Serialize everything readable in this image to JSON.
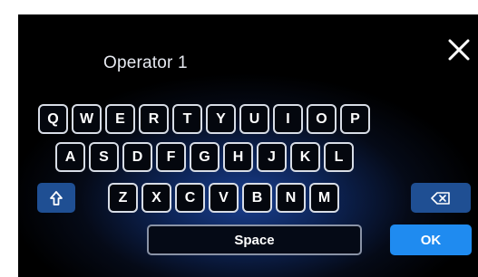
{
  "input": {
    "value": "Operator 1"
  },
  "keyboard": {
    "row1": [
      "Q",
      "W",
      "E",
      "R",
      "T",
      "Y",
      "U",
      "I",
      "O",
      "P"
    ],
    "row2": [
      "A",
      "S",
      "D",
      "F",
      "G",
      "H",
      "J",
      "K",
      "L"
    ],
    "row3": [
      "Z",
      "X",
      "C",
      "V",
      "B",
      "N",
      "M"
    ],
    "space_label": "Space",
    "ok_label": "OK"
  },
  "icons": {
    "close": "close-icon",
    "shift": "shift-icon",
    "backspace": "backspace-icon"
  },
  "colors": {
    "accent": "#1f8bf0",
    "action_key": "#1f4f93",
    "key_border": "#d8dde6",
    "background": "#000000"
  }
}
